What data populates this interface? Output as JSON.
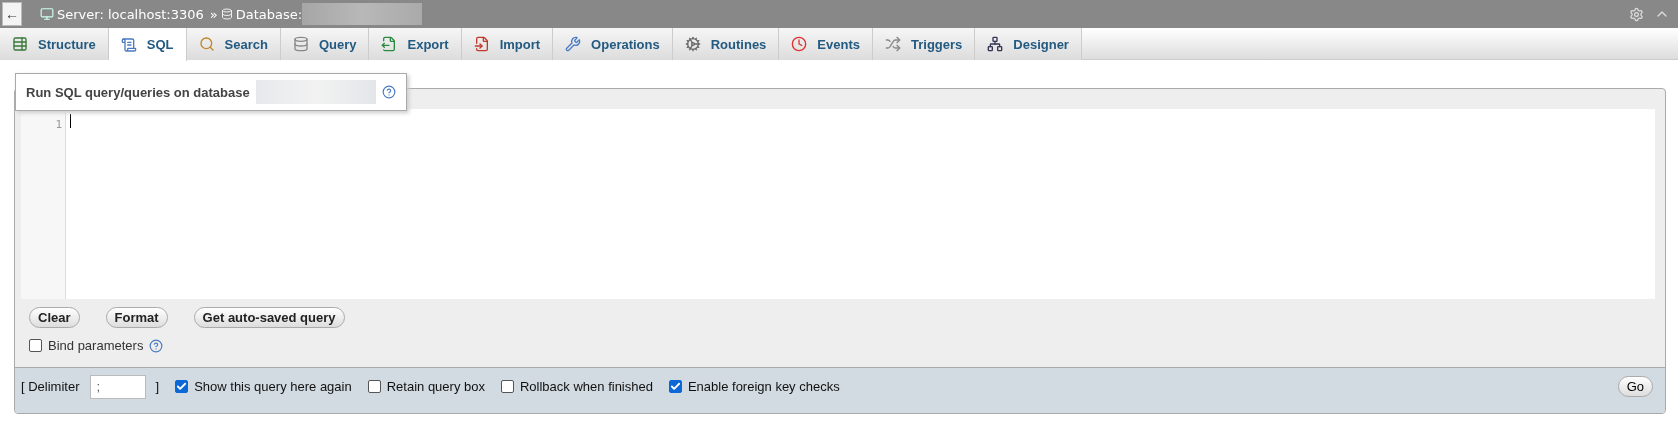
{
  "breadcrumb": {
    "back": "←",
    "server": "Server: localhost:3306",
    "separator": "»",
    "database": "Database:"
  },
  "tabs": [
    {
      "label": "Structure",
      "selected": false
    },
    {
      "label": "SQL",
      "selected": true
    },
    {
      "label": "Search",
      "selected": false
    },
    {
      "label": "Query",
      "selected": false
    },
    {
      "label": "Export",
      "selected": false
    },
    {
      "label": "Import",
      "selected": false
    },
    {
      "label": "Operations",
      "selected": false
    },
    {
      "label": "Routines",
      "selected": false
    },
    {
      "label": "Events",
      "selected": false
    },
    {
      "label": "Triggers",
      "selected": false
    },
    {
      "label": "Designer",
      "selected": false
    }
  ],
  "query_panel": {
    "legend": "Run SQL query/queries on database",
    "editor": {
      "line_numbers": [
        "1"
      ]
    },
    "buttons": [
      "Clear",
      "Format",
      "Get auto-saved query"
    ],
    "bind_parameters": {
      "label": "Bind parameters",
      "checked": false
    }
  },
  "footer": {
    "delimiter_open": "[ Delimiter",
    "delimiter": ";",
    "delimiter_close": "]",
    "options": [
      {
        "label": "Show this query here again",
        "checked": true
      },
      {
        "label": "Retain query box",
        "checked": false
      },
      {
        "label": "Rollback when finished",
        "checked": false
      },
      {
        "label": "Enable foreign key checks",
        "checked": true
      }
    ],
    "go": "Go"
  }
}
